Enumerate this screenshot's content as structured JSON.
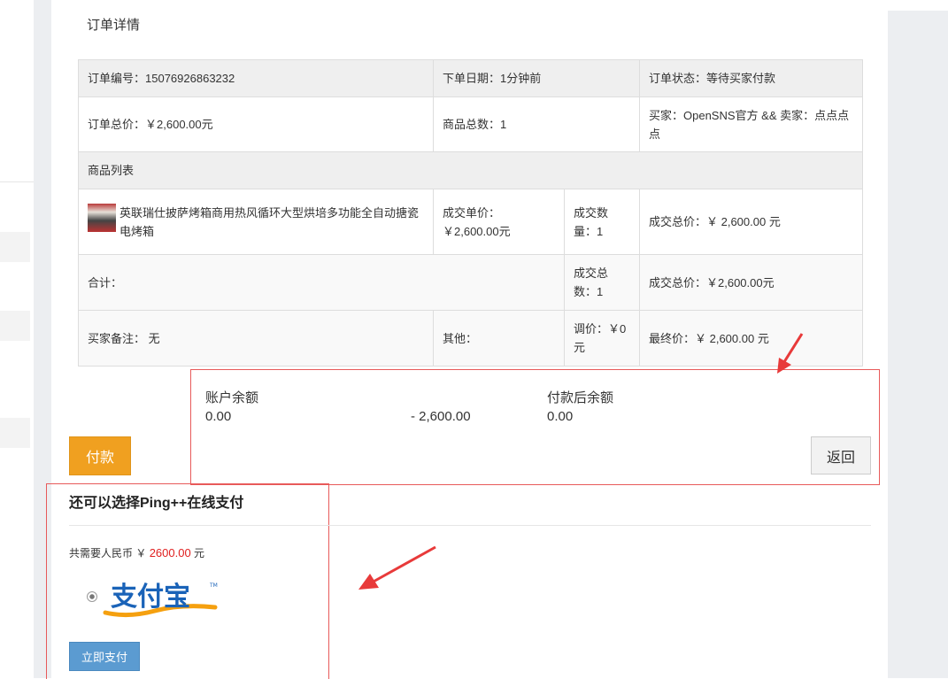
{
  "page": {
    "title": "订单详情"
  },
  "order": {
    "number_label": "订单编号：",
    "number": "15076926863232",
    "date_label": "下单日期：",
    "date": "1分钟前",
    "status_label": "订单状态：",
    "status": "等待买家付款",
    "total_label": "订单总价：",
    "total": "￥2,600.00元",
    "qty_label": "商品总数：",
    "qty": "1",
    "parties": "买家：OpenSNS官方 && 卖家：点点点点"
  },
  "products": {
    "section_label": "商品列表",
    "items": [
      {
        "name": "英联瑞仕披萨烤箱商用热风循环大型烘培多功能全自动搪瓷电烤箱",
        "unit_price": "成交单价：￥2,600.00元",
        "quantity": "成交数量：1",
        "total": "成交总价：￥ 2,600.00 元"
      }
    ]
  },
  "summary": {
    "label": "合计：",
    "count": "成交总数：1",
    "total": "成交总价：￥2,600.00元"
  },
  "remarks": {
    "buyer_note": "买家备注： 无",
    "other": "其他：",
    "adjust": "调价：￥0元",
    "final": "最终价：￥ 2,600.00 元"
  },
  "balance": {
    "account_label": "账户余额",
    "account_value": "0.00",
    "deduct_value": "- 2,600.00",
    "after_label": "付款后余额",
    "after_value": "0.00"
  },
  "buttons": {
    "pay": "付款",
    "back": "返回",
    "pay_now": "立即支付"
  },
  "ping": {
    "title": "还可以选择Ping++在线支付",
    "need_prefix": "共需要人民币 ￥",
    "need_amount": "2600.00",
    "need_suffix": "元",
    "method_logo_text": "支付宝"
  },
  "colors": {
    "pay_button": "#f0a020",
    "pay_now_button": "#5b9bd1",
    "annotation_red": "#e85a5a",
    "amount_red": "#e02020",
    "alipay_blue": "#1a63b8",
    "alipay_orange": "#f5a00f"
  }
}
